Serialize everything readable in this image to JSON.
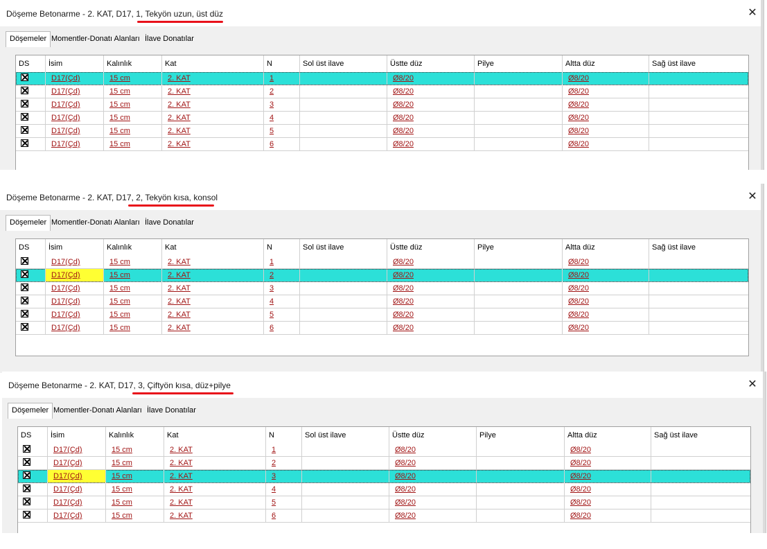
{
  "columns": [
    "DS",
    "İsim",
    "Kalınlık",
    "Kat",
    "N",
    "Sol üst ilave",
    "Üstte düz",
    "Pilye",
    "Altta düz",
    "Sağ üst ilave"
  ],
  "tabs": [
    "Döşemeler",
    "Momentler-Donatı Alanları",
    "İlave Donatılar"
  ],
  "close_label": "✕",
  "colors": {
    "selected_row": "#2ce0d8",
    "highlight_cell": "#ffff33",
    "link": "#a11414",
    "annotation": "#e8111a"
  },
  "dialogs": [
    {
      "title": "Döşeme Betonarme - 2. KAT, D17, 1, Tekyön uzun, üst düz",
      "rows": [
        {
          "isim": "D17(Çd)",
          "kalinlik": "15 cm",
          "kat": "2. KAT",
          "n": "1",
          "sol": "",
          "ustte": "Ø8/20",
          "pilye": "",
          "altta": "Ø8/20",
          "sag": ""
        },
        {
          "isim": "D17(Çd)",
          "kalinlik": "15 cm",
          "kat": "2. KAT",
          "n": "2",
          "sol": "",
          "ustte": "Ø8/20",
          "pilye": "",
          "altta": "Ø8/20",
          "sag": ""
        },
        {
          "isim": "D17(Çd)",
          "kalinlik": "15 cm",
          "kat": "2. KAT",
          "n": "3",
          "sol": "",
          "ustte": "Ø8/20",
          "pilye": "",
          "altta": "Ø8/20",
          "sag": ""
        },
        {
          "isim": "D17(Çd)",
          "kalinlik": "15 cm",
          "kat": "2. KAT",
          "n": "4",
          "sol": "",
          "ustte": "Ø8/20",
          "pilye": "",
          "altta": "Ø8/20",
          "sag": ""
        },
        {
          "isim": "D17(Çd)",
          "kalinlik": "15 cm",
          "kat": "2. KAT",
          "n": "5",
          "sol": "",
          "ustte": "Ø8/20",
          "pilye": "",
          "altta": "Ø8/20",
          "sag": ""
        },
        {
          "isim": "D17(Çd)",
          "kalinlik": "15 cm",
          "kat": "2. KAT",
          "n": "6",
          "sol": "",
          "ustte": "Ø8/20",
          "pilye": "",
          "altta": "Ø8/20",
          "sag": ""
        }
      ],
      "selected_row": 0,
      "yellow_name": false
    },
    {
      "title": "Döşeme Betonarme - 2. KAT, D17, 2, Tekyön kısa, konsol",
      "rows": [
        {
          "isim": "D17(Çd)",
          "kalinlik": "15 cm",
          "kat": "2. KAT",
          "n": "1",
          "sol": "",
          "ustte": "Ø8/20",
          "pilye": "",
          "altta": "Ø8/20",
          "sag": ""
        },
        {
          "isim": "D17(Çd)",
          "kalinlik": "15 cm",
          "kat": "2. KAT",
          "n": "2",
          "sol": "",
          "ustte": "Ø8/20",
          "pilye": "",
          "altta": "Ø8/20",
          "sag": ""
        },
        {
          "isim": "D17(Çd)",
          "kalinlik": "15 cm",
          "kat": "2. KAT",
          "n": "3",
          "sol": "",
          "ustte": "Ø8/20",
          "pilye": "",
          "altta": "Ø8/20",
          "sag": ""
        },
        {
          "isim": "D17(Çd)",
          "kalinlik": "15 cm",
          "kat": "2. KAT",
          "n": "4",
          "sol": "",
          "ustte": "Ø8/20",
          "pilye": "",
          "altta": "Ø8/20",
          "sag": ""
        },
        {
          "isim": "D17(Çd)",
          "kalinlik": "15 cm",
          "kat": "2. KAT",
          "n": "5",
          "sol": "",
          "ustte": "Ø8/20",
          "pilye": "",
          "altta": "Ø8/20",
          "sag": ""
        },
        {
          "isim": "D17(Çd)",
          "kalinlik": "15 cm",
          "kat": "2. KAT",
          "n": "6",
          "sol": "",
          "ustte": "Ø8/20",
          "pilye": "",
          "altta": "Ø8/20",
          "sag": ""
        }
      ],
      "selected_row": 1,
      "yellow_name": true
    },
    {
      "title": "Döşeme Betonarme - 2. KAT, D17, 3, Çiftyön kısa, düz+pilye",
      "rows": [
        {
          "isim": "D17(Çd)",
          "kalinlik": "15 cm",
          "kat": "2. KAT",
          "n": "1",
          "sol": "",
          "ustte": "Ø8/20",
          "pilye": "",
          "altta": "Ø8/20",
          "sag": ""
        },
        {
          "isim": "D17(Çd)",
          "kalinlik": "15 cm",
          "kat": "2. KAT",
          "n": "2",
          "sol": "",
          "ustte": "Ø8/20",
          "pilye": "",
          "altta": "Ø8/20",
          "sag": ""
        },
        {
          "isim": "D17(Çd)",
          "kalinlik": "15 cm",
          "kat": "2. KAT",
          "n": "3",
          "sol": "",
          "ustte": "Ø8/20",
          "pilye": "",
          "altta": "Ø8/20",
          "sag": ""
        },
        {
          "isim": "D17(Çd)",
          "kalinlik": "15 cm",
          "kat": "2. KAT",
          "n": "4",
          "sol": "",
          "ustte": "Ø8/20",
          "pilye": "",
          "altta": "Ø8/20",
          "sag": ""
        },
        {
          "isim": "D17(Çd)",
          "kalinlik": "15 cm",
          "kat": "2. KAT",
          "n": "5",
          "sol": "",
          "ustte": "Ø8/20",
          "pilye": "",
          "altta": "Ø8/20",
          "sag": ""
        },
        {
          "isim": "D17(Çd)",
          "kalinlik": "15 cm",
          "kat": "2. KAT",
          "n": "6",
          "sol": "",
          "ustte": "Ø8/20",
          "pilye": "",
          "altta": "Ø8/20",
          "sag": ""
        }
      ],
      "selected_row": 2,
      "yellow_name": true
    }
  ]
}
